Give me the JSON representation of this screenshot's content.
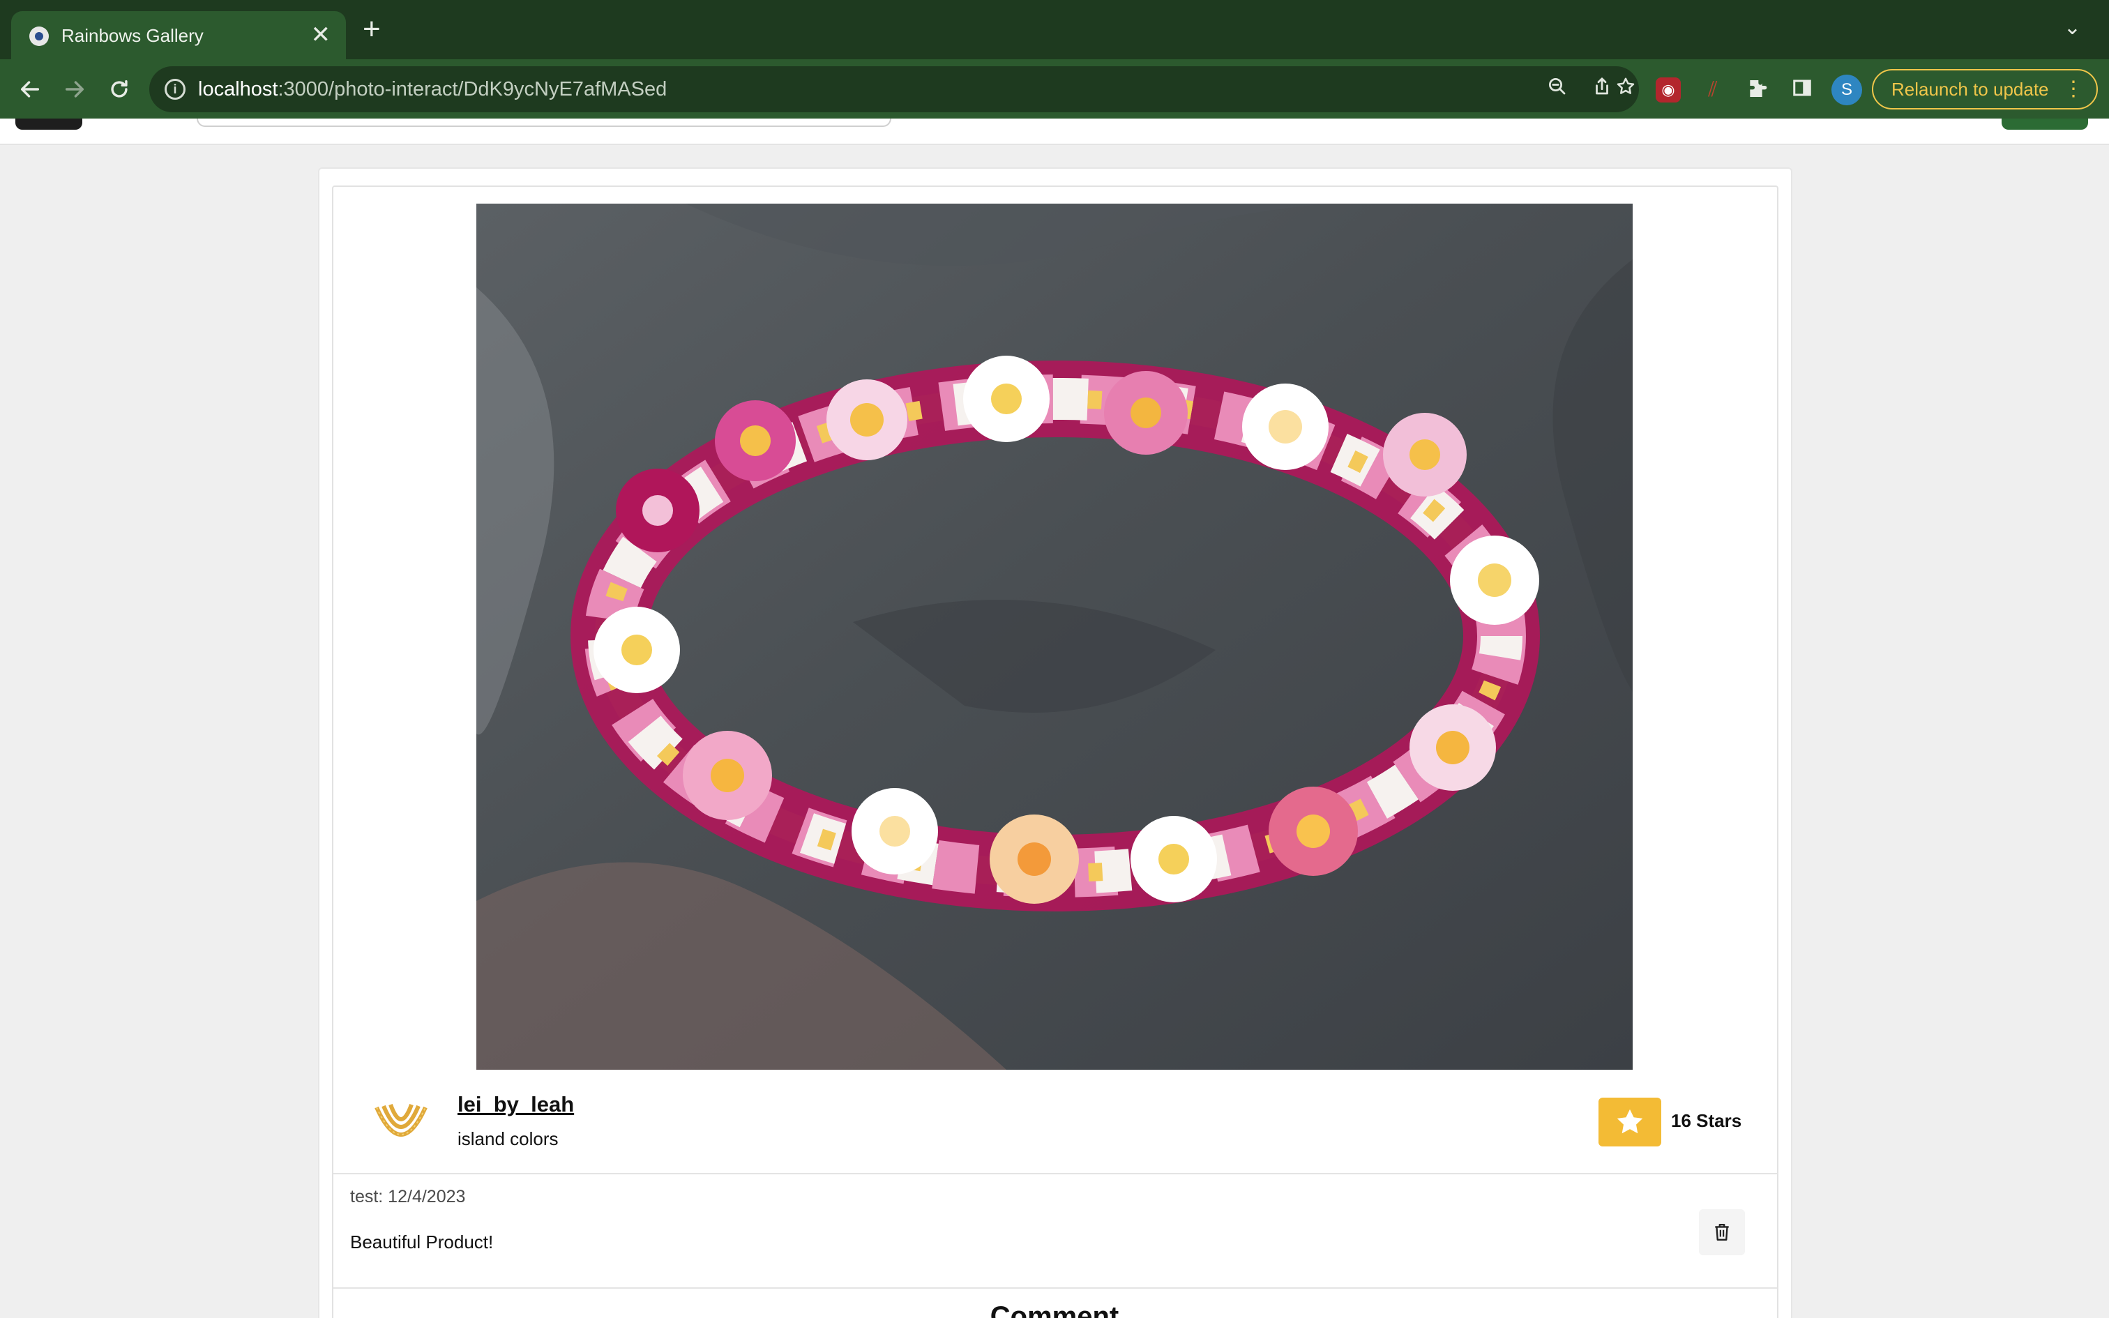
{
  "browser": {
    "tab_title": "Rainbows Gallery",
    "tab_close": "✕",
    "new_tab": "+",
    "tab_menu": "⌄",
    "url_host": "localhost",
    "url_path": ":3000/photo-interact/DdK9ycNyE7afMASed",
    "profile_initial": "S",
    "relaunch_label": "Relaunch to update",
    "relaunch_menu": "⋮"
  },
  "post": {
    "username": "lei_by_leah",
    "caption": "island colors",
    "stars_label": "16 Stars"
  },
  "comments": [
    {
      "meta": "test: 12/4/2023",
      "text": "Beautiful Product!"
    }
  ],
  "comment_section": {
    "heading": "Comment"
  },
  "colors": {
    "chrome_dark": "#1e3a1f",
    "chrome": "#2c5a2e",
    "relaunch_accent": "#f0c64a",
    "star_button": "#f3bb35",
    "page_bg": "#efefef"
  },
  "icons": {
    "back": "arrow-left-icon",
    "forward": "arrow-right-icon",
    "reload": "reload-icon",
    "zoom": "zoom-icon",
    "share": "share-icon",
    "bookmark": "star-outline-icon",
    "extensions": "puzzle-icon",
    "sidepanel": "side-panel-icon",
    "star": "star-icon",
    "delete": "trash-icon"
  }
}
